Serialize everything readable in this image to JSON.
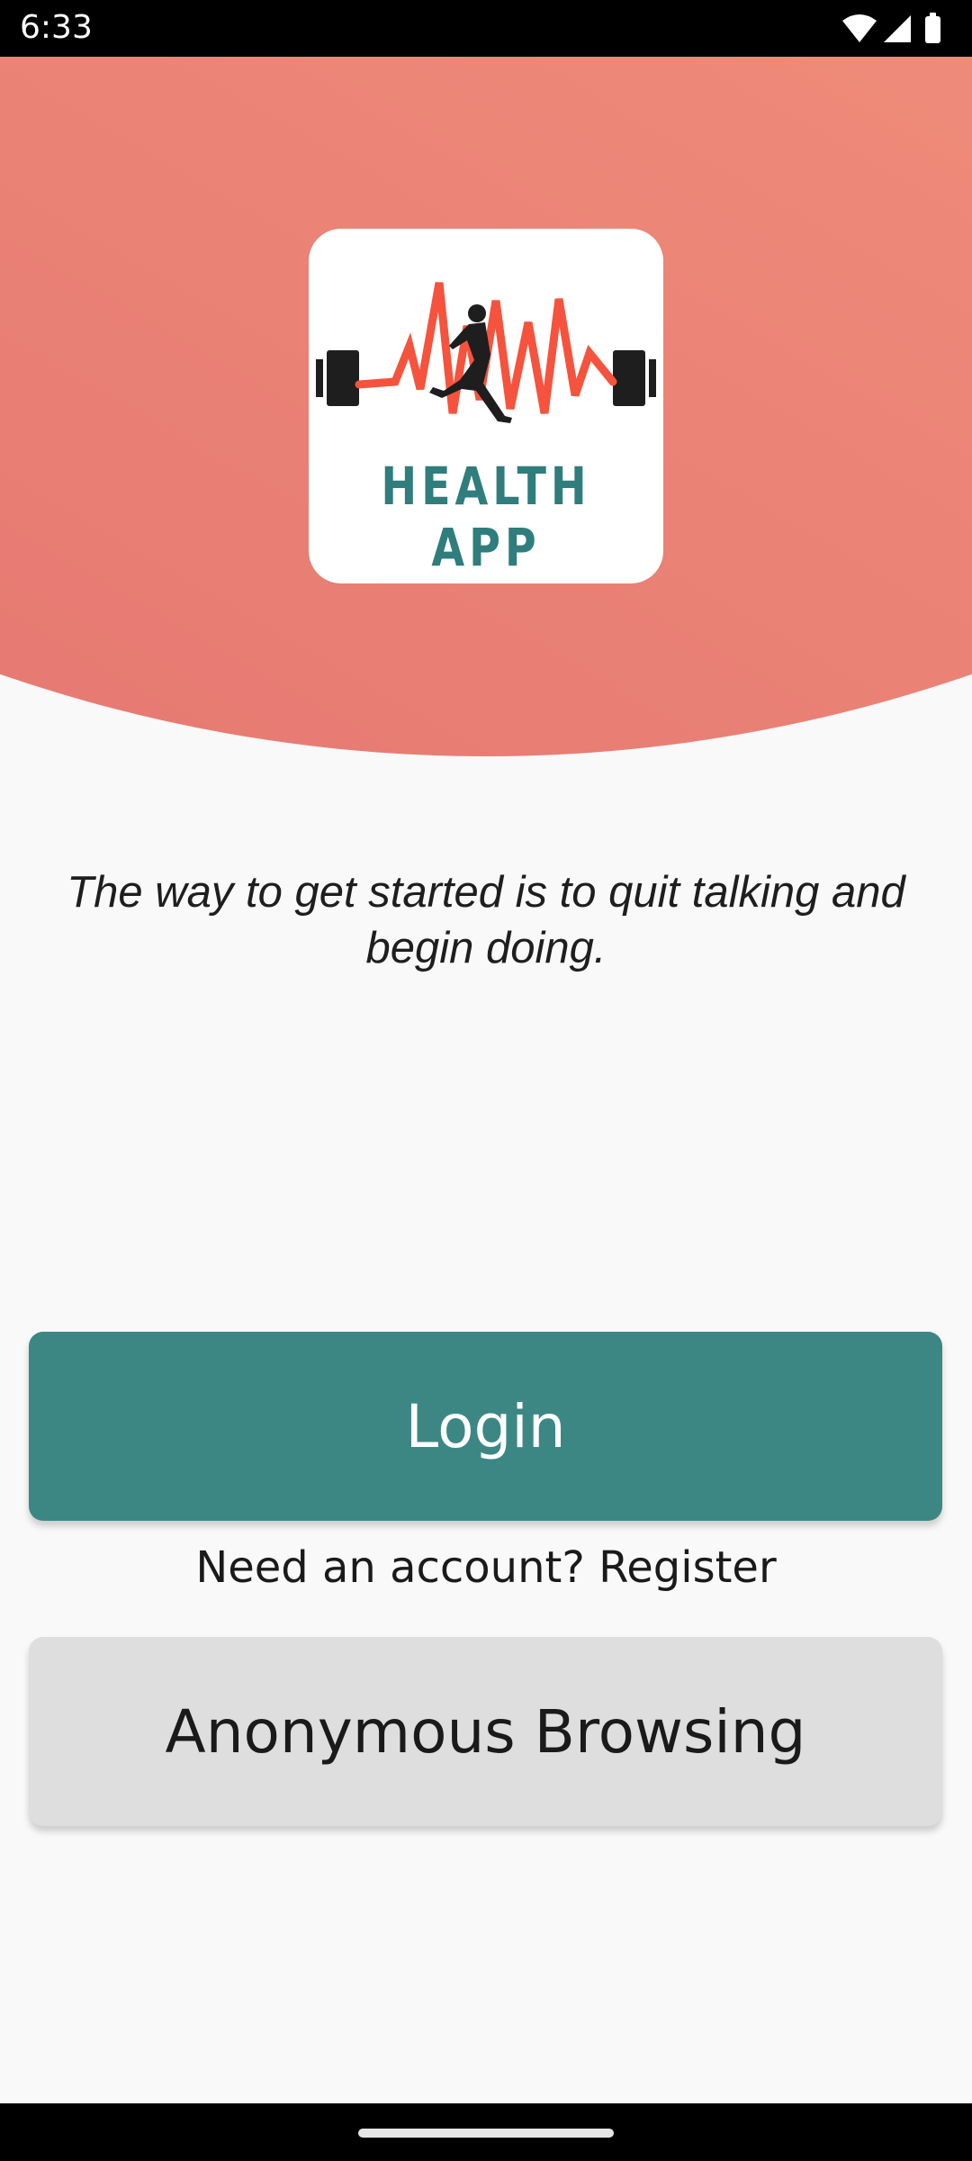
{
  "status_bar": {
    "time": "6:33",
    "icons": [
      "wifi-icon",
      "signal-icon",
      "battery-icon"
    ]
  },
  "logo": {
    "text": "HEALTH APP",
    "text_color": "#2f7d7c",
    "pulse_color": "#f5533d"
  },
  "quote": {
    "text": "The way to get started is to quit talking and begin doing."
  },
  "buttons": {
    "login_label": "Login",
    "register_link": "Need an account? Register",
    "anonymous_label": "Anonymous Browsing"
  },
  "colors": {
    "hero_gradient_light": "#f8a987",
    "hero_gradient_dark": "#e2706f",
    "primary": "#3c8784",
    "secondary_button": "#dedede",
    "background": "#f9f9f9"
  }
}
